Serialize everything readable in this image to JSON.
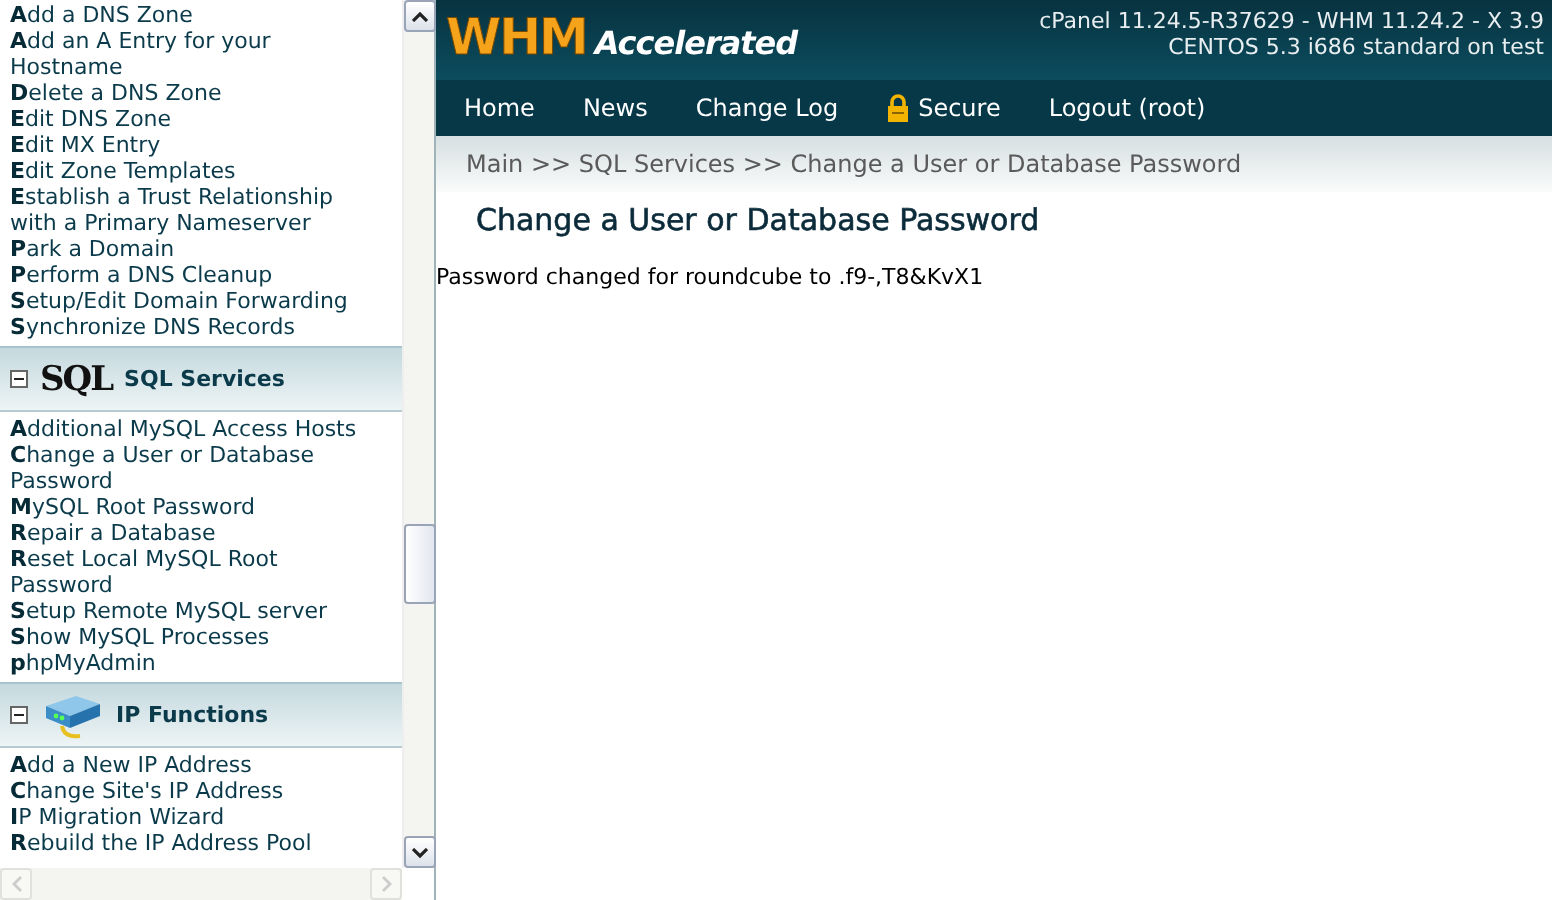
{
  "sidebar": {
    "top_items": [
      {
        "label": "**A**dd a DNS Zone"
      },
      {
        "label": "**A**dd an A Entry for your Hostname"
      },
      {
        "label": "**D**elete a DNS Zone"
      },
      {
        "label": "**E**dit DNS Zone"
      },
      {
        "label": "**E**dit MX Entry"
      },
      {
        "label": "**E**dit Zone Templates"
      },
      {
        "label": "**E**stablish a Trust Relationship with a Primary Nameserver"
      },
      {
        "label": "**P**ark a Domain"
      },
      {
        "label": "**P**erform a DNS Cleanup"
      },
      {
        "label": "**S**etup/Edit Domain Forwarding"
      },
      {
        "label": "**S**ynchronize DNS Records"
      }
    ],
    "sections": [
      {
        "kind": "sql",
        "logo_text": "SQL",
        "title": "SQL Services",
        "expanded": true,
        "items": [
          {
            "label": "**A**dditional MySQL Access Hosts"
          },
          {
            "label": "**C**hange a User or Database Password"
          },
          {
            "label": "**M**ySQL Root Password"
          },
          {
            "label": "**R**epair a Database"
          },
          {
            "label": "**R**eset Local MySQL Root Password"
          },
          {
            "label": "**S**etup Remote MySQL server"
          },
          {
            "label": "**S**how MySQL Processes"
          },
          {
            "label": "**p**hpMyAdmin"
          }
        ]
      },
      {
        "kind": "ip",
        "title": "IP Functions",
        "expanded": true,
        "items": [
          {
            "label": "**A**dd a New IP Address"
          },
          {
            "label": "**C**hange Site's IP Address"
          },
          {
            "label": "**I**P Migration Wizard"
          },
          {
            "label": "**R**ebuild the IP Address Pool"
          }
        ]
      }
    ]
  },
  "header": {
    "logo_main": "WHM",
    "logo_sub": "Accelerated",
    "version_lines": [
      "cPanel 11.24.5-R37629 - WHM 11.24.2 - X 3.9",
      "CENTOS 5.3 i686 standard on test"
    ]
  },
  "nav": [
    {
      "kind": "link",
      "label": "Home"
    },
    {
      "kind": "link",
      "label": "News"
    },
    {
      "kind": "link",
      "label": "Change Log"
    },
    {
      "kind": "secure",
      "label": "Secure"
    },
    {
      "kind": "link",
      "label": "Logout (root)"
    }
  ],
  "breadcrumb": "Main >> SQL Services >> Change a User or Database Password",
  "page_title": "Change a User or Database Password",
  "message": "Password changed for roundcube to .f9-,T8&KvX1"
}
